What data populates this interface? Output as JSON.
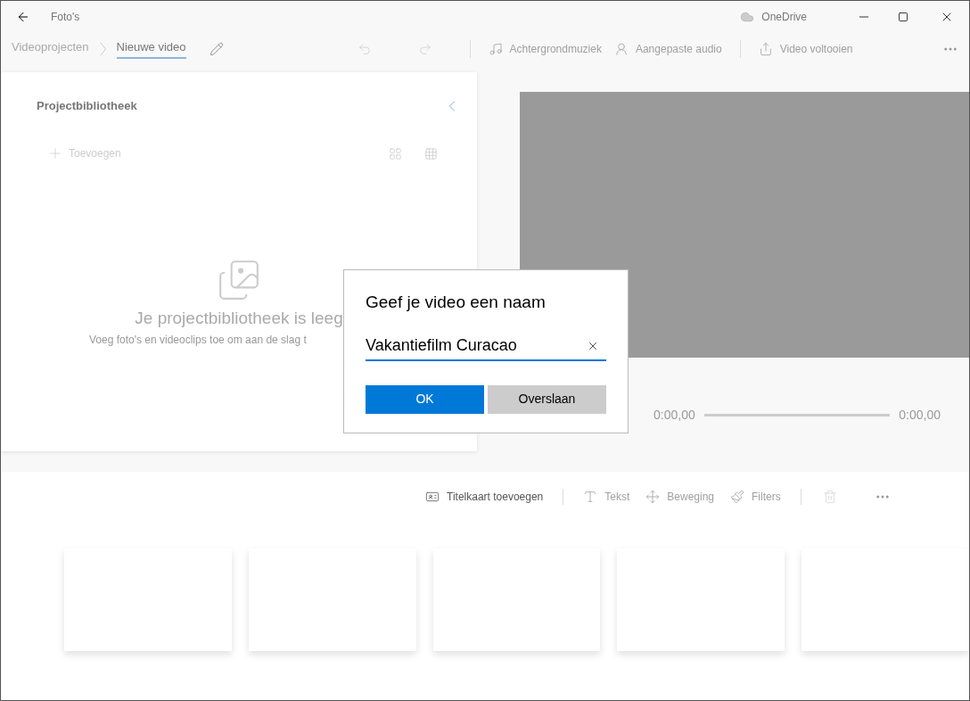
{
  "window": {
    "app": "Foto's",
    "cloud": "OneDrive"
  },
  "breadcrumb": [
    {
      "label": "Videoprojecten",
      "selected": false
    },
    {
      "label": "Nieuwe video",
      "selected": true
    }
  ],
  "toolbar": [
    {
      "label": "Achtergrondmuziek",
      "kind": "music",
      "disabled": true
    },
    {
      "label": "Aangepaste audio",
      "kind": "audio",
      "disabled": true
    },
    {
      "label": "Video voltooien",
      "kind": "share",
      "disabled": true
    }
  ],
  "library": {
    "title": "Projectbibliotheek",
    "add": {
      "label": "Toevoegen",
      "disabled": true
    },
    "empty_title": "Je projectbibliotheek is leeg",
    "empty_text": "Voeg foto's en videoclips toe om aan de slag t"
  },
  "player": {
    "time_start": "0:00,00",
    "time_end": "0:00,00"
  },
  "storyboard": {
    "tools": [
      {
        "label": "Titelkaart toevoegen",
        "kind": "titlecard",
        "disabled": false
      },
      {
        "label": "Tekst",
        "kind": "text",
        "disabled": true
      },
      {
        "label": "Beweging",
        "kind": "motion",
        "disabled": true
      },
      {
        "label": "Filters",
        "kind": "filters",
        "disabled": true
      }
    ]
  },
  "dialog": {
    "title": "Geef je video een naam",
    "value": "Vakantiefilm Curacao",
    "buttons": [
      {
        "label": "OK",
        "kind": "primary"
      },
      {
        "label": "Overslaan",
        "kind": "secondary"
      }
    ]
  }
}
